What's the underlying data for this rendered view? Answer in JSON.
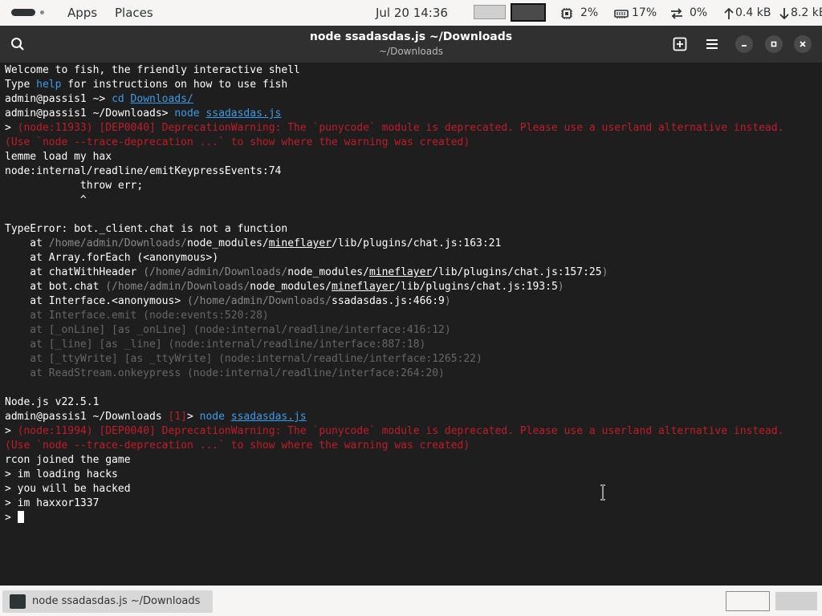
{
  "top_panel": {
    "apps_label": "Apps",
    "places_label": "Places",
    "clock": "Jul 20  14:36",
    "cpu": "2%",
    "memory": "17%",
    "swap": "0%",
    "upload": "0.4 kB",
    "download": "8.2 kB"
  },
  "window": {
    "title": "node ssadasdas.js ~/Downloads",
    "subtitle": "~/Downloads"
  },
  "terminal": {
    "lines": [
      [
        {
          "t": "Welcome to fish, the friendly interactive shell",
          "c": "c-white"
        }
      ],
      [
        {
          "t": "Type ",
          "c": "c-white"
        },
        {
          "t": "help",
          "c": "c-cyan"
        },
        {
          "t": " for instructions on how to use fish",
          "c": "c-white"
        }
      ],
      [
        {
          "t": "admin@passis1 ",
          "c": "c-white"
        },
        {
          "t": "~",
          "c": "c-white"
        },
        {
          "t": "> ",
          "c": "c-white"
        },
        {
          "t": "cd ",
          "c": "c-cyan"
        },
        {
          "t": "Downloads/",
          "c": "c-link"
        }
      ],
      [
        {
          "t": "admin@passis1 ",
          "c": "c-white"
        },
        {
          "t": "~/Downloads",
          "c": "c-white"
        },
        {
          "t": "> ",
          "c": "c-white"
        },
        {
          "t": "node ",
          "c": "c-cyan"
        },
        {
          "t": "ssadasdas.js",
          "c": "c-link"
        }
      ],
      [
        {
          "t": "> ",
          "c": "c-white"
        },
        {
          "t": "(node:11933) [DEP0040] DeprecationWarning: The `punycode` module is deprecated. Please use a userland alternative instead.",
          "c": "c-red"
        }
      ],
      [
        {
          "t": "(Use `node --trace-deprecation ...` to show where the warning was created)",
          "c": "c-red"
        }
      ],
      [
        {
          "t": "lemme load my hax",
          "c": "c-white"
        }
      ],
      [
        {
          "t": "node:internal/readline/emitKeypressEvents:74",
          "c": "c-white"
        }
      ],
      [
        {
          "t": "            throw err;",
          "c": "c-white"
        }
      ],
      [
        {
          "t": "            ^",
          "c": "c-white"
        }
      ],
      [
        {
          "t": "",
          "c": "c-white"
        }
      ],
      [
        {
          "t": "TypeError: bot._client.chat is not a function",
          "c": "c-white"
        }
      ],
      [
        {
          "t": "    at ",
          "c": "c-white"
        },
        {
          "t": "/home/admin/Downloads/",
          "c": "c-gray"
        },
        {
          "t": "node_modules/",
          "c": "c-white"
        },
        {
          "t": "mineflayer",
          "c": "c-under"
        },
        {
          "t": "/lib/plugins/chat.js:163:21",
          "c": "c-white"
        }
      ],
      [
        {
          "t": "    at Array.forEach (<anonymous>)",
          "c": "c-white"
        }
      ],
      [
        {
          "t": "    at chatWithHeader ",
          "c": "c-white"
        },
        {
          "t": "(/home/admin/Downloads/",
          "c": "c-gray"
        },
        {
          "t": "node_modules/",
          "c": "c-white"
        },
        {
          "t": "mineflayer",
          "c": "c-under"
        },
        {
          "t": "/lib/plugins/chat.js:157:25",
          "c": "c-white"
        },
        {
          "t": ")",
          "c": "c-gray"
        }
      ],
      [
        {
          "t": "    at bot.chat ",
          "c": "c-white"
        },
        {
          "t": "(/home/admin/Downloads/",
          "c": "c-gray"
        },
        {
          "t": "node_modules/",
          "c": "c-white"
        },
        {
          "t": "mineflayer",
          "c": "c-under"
        },
        {
          "t": "/lib/plugins/chat.js:193:5",
          "c": "c-white"
        },
        {
          "t": ")",
          "c": "c-gray"
        }
      ],
      [
        {
          "t": "    at Interface.<anonymous> ",
          "c": "c-white"
        },
        {
          "t": "(/home/admin/Downloads/",
          "c": "c-gray"
        },
        {
          "t": "ssadasdas.js:466:9",
          "c": "c-white"
        },
        {
          "t": ")",
          "c": "c-gray"
        }
      ],
      [
        {
          "t": "    at Interface.emit (node:events:520:28)",
          "c": "c-dim"
        }
      ],
      [
        {
          "t": "    at [_onLine] [as _onLine] (node:internal/readline/interface:416:12)",
          "c": "c-dim"
        }
      ],
      [
        {
          "t": "    at [_line] [as _line] (node:internal/readline/interface:887:18)",
          "c": "c-dim"
        }
      ],
      [
        {
          "t": "    at [_ttyWrite] [as _ttyWrite] (node:internal/readline/interface:1265:22)",
          "c": "c-dim"
        }
      ],
      [
        {
          "t": "    at ReadStream.onkeypress (node:internal/readline/interface:264:20)",
          "c": "c-dim"
        }
      ],
      [
        {
          "t": "",
          "c": "c-white"
        }
      ],
      [
        {
          "t": "Node.js v22.5.1",
          "c": "c-white"
        }
      ],
      [
        {
          "t": "admin@passis1 ",
          "c": "c-white"
        },
        {
          "t": "~/Downloads ",
          "c": "c-white"
        },
        {
          "t": "[1]",
          "c": "c-red"
        },
        {
          "t": "> ",
          "c": "c-white"
        },
        {
          "t": "node ",
          "c": "c-cyan"
        },
        {
          "t": "ssadasdas.js",
          "c": "c-link"
        }
      ],
      [
        {
          "t": "> ",
          "c": "c-white"
        },
        {
          "t": "(node:11994) [DEP0040] DeprecationWarning: The `punycode` module is deprecated. Please use a userland alternative instead.",
          "c": "c-red"
        }
      ],
      [
        {
          "t": "(Use `node --trace-deprecation ...` to show where the warning was created)",
          "c": "c-red"
        }
      ],
      [
        {
          "t": "rcon joined the game",
          "c": "c-white"
        }
      ],
      [
        {
          "t": "> im loading hacks",
          "c": "c-white"
        }
      ],
      [
        {
          "t": "> you will be hacked",
          "c": "c-white"
        }
      ],
      [
        {
          "t": "> im haxxor1337",
          "c": "c-white"
        }
      ]
    ],
    "prompt": "> "
  },
  "taskbar": {
    "task_label": "node ssadasdas.js ~/Downloads"
  }
}
